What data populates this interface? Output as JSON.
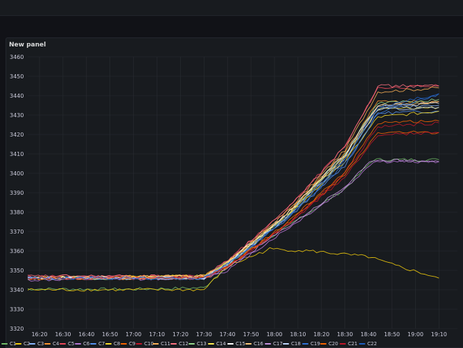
{
  "topbar": {},
  "panel": {
    "title": "New panel"
  },
  "chart_data": {
    "type": "line",
    "title": "New panel",
    "ylim": [
      3320,
      3460
    ],
    "y_ticks": [
      "3460",
      "3450",
      "3440",
      "3430",
      "3420",
      "3410",
      "3400",
      "3390",
      "3380",
      "3370",
      "3360",
      "3350",
      "3340",
      "3330",
      "3320"
    ],
    "x_ticks": [
      "16:20",
      "16:30",
      "16:40",
      "16:50",
      "17:00",
      "17:10",
      "17:20",
      "17:30",
      "17:40",
      "17:50",
      "18:00",
      "18:10",
      "18:20",
      "18:30",
      "18:40",
      "18:50",
      "19:00",
      "19:10"
    ],
    "x_minutes": [
      975,
      1150
    ],
    "grid": true,
    "legend_position": "bottom",
    "series": [
      {
        "name": "C1",
        "color": "#73bf69",
        "values": [
          [
            975,
            3340.5
          ],
          [
            1015,
            3340.2
          ],
          [
            1050,
            3341
          ],
          [
            1063,
            3356
          ],
          [
            1085,
            3372
          ],
          [
            1110,
            3392
          ],
          [
            1122,
            3407
          ],
          [
            1150,
            3407
          ]
        ]
      },
      {
        "name": "C2",
        "color": "#f2cc0c",
        "values": [
          [
            975,
            3340
          ],
          [
            1050,
            3340
          ],
          [
            1060,
            3352
          ],
          [
            1072,
            3358
          ],
          [
            1078,
            3361
          ],
          [
            1095,
            3360
          ],
          [
            1120,
            3357
          ],
          [
            1130,
            3353
          ],
          [
            1150,
            3346
          ]
        ]
      },
      {
        "name": "C3",
        "color": "#8ab8ff",
        "values": [
          [
            975,
            3346
          ],
          [
            1050,
            3346
          ],
          [
            1060,
            3353
          ],
          [
            1085,
            3378
          ],
          [
            1110,
            3409
          ],
          [
            1124,
            3434
          ],
          [
            1150,
            3435
          ]
        ]
      },
      {
        "name": "C4",
        "color": "#ff9830",
        "values": [
          [
            975,
            3346
          ],
          [
            1050,
            3347
          ],
          [
            1060,
            3354
          ],
          [
            1085,
            3379
          ],
          [
            1110,
            3411
          ],
          [
            1124,
            3437
          ],
          [
            1150,
            3437
          ]
        ]
      },
      {
        "name": "C5",
        "color": "#f2495c",
        "values": [
          [
            975,
            3347
          ],
          [
            1050,
            3347
          ],
          [
            1060,
            3355
          ],
          [
            1085,
            3381
          ],
          [
            1110,
            3414
          ],
          [
            1124,
            3444
          ],
          [
            1150,
            3445
          ]
        ]
      },
      {
        "name": "C6",
        "color": "#b877d9",
        "values": [
          [
            975,
            3345
          ],
          [
            1050,
            3346
          ],
          [
            1060,
            3350
          ],
          [
            1085,
            3371
          ],
          [
            1110,
            3392
          ],
          [
            1122,
            3406
          ],
          [
            1150,
            3406
          ]
        ]
      },
      {
        "name": "C7",
        "color": "#5794f2",
        "values": [
          [
            975,
            3346
          ],
          [
            1050,
            3346
          ],
          [
            1060,
            3353
          ],
          [
            1085,
            3376
          ],
          [
            1110,
            3404
          ],
          [
            1124,
            3431
          ],
          [
            1150,
            3432
          ]
        ]
      },
      {
        "name": "C8",
        "color": "#fade2a",
        "values": [
          [
            975,
            3346
          ],
          [
            1050,
            3347
          ],
          [
            1060,
            3353
          ],
          [
            1085,
            3377
          ],
          [
            1110,
            3406
          ],
          [
            1124,
            3429
          ],
          [
            1150,
            3432
          ]
        ]
      },
      {
        "name": "C9",
        "color": "#fa6400",
        "values": [
          [
            975,
            3346
          ],
          [
            1050,
            3346
          ],
          [
            1060,
            3352
          ],
          [
            1085,
            3374
          ],
          [
            1110,
            3399
          ],
          [
            1124,
            3421
          ],
          [
            1150,
            3421
          ]
        ]
      },
      {
        "name": "C10",
        "color": "#c4162a",
        "values": [
          [
            975,
            3346
          ],
          [
            1050,
            3346
          ],
          [
            1060,
            3352
          ],
          [
            1085,
            3373
          ],
          [
            1110,
            3400
          ],
          [
            1124,
            3424
          ],
          [
            1150,
            3426
          ]
        ]
      },
      {
        "name": "C11",
        "color": "#ffb357",
        "values": [
          [
            975,
            3346
          ],
          [
            1050,
            3346
          ],
          [
            1060,
            3354
          ],
          [
            1085,
            3380
          ],
          [
            1110,
            3412
          ],
          [
            1124,
            3442
          ],
          [
            1150,
            3444
          ]
        ]
      },
      {
        "name": "C12",
        "color": "#ff7383",
        "values": [
          [
            975,
            3347
          ],
          [
            1050,
            3347
          ],
          [
            1060,
            3355
          ],
          [
            1085,
            3381
          ],
          [
            1110,
            3414
          ],
          [
            1124,
            3445
          ],
          [
            1150,
            3445
          ]
        ]
      },
      {
        "name": "C13",
        "color": "#96d98d",
        "values": [
          [
            975,
            3346
          ],
          [
            1050,
            3346
          ],
          [
            1060,
            3354
          ],
          [
            1085,
            3378
          ],
          [
            1110,
            3410
          ],
          [
            1124,
            3436
          ],
          [
            1150,
            3438
          ]
        ]
      },
      {
        "name": "C14",
        "color": "#ffee52",
        "values": [
          [
            975,
            3346
          ],
          [
            1050,
            3347
          ],
          [
            1060,
            3354
          ],
          [
            1085,
            3378
          ],
          [
            1110,
            3408
          ],
          [
            1124,
            3433
          ],
          [
            1150,
            3434
          ]
        ]
      },
      {
        "name": "C15",
        "color": "#ffffff",
        "values": [
          [
            975,
            3346
          ],
          [
            1050,
            3346
          ],
          [
            1060,
            3354
          ],
          [
            1085,
            3379
          ],
          [
            1110,
            3410
          ],
          [
            1124,
            3435
          ],
          [
            1150,
            3436
          ]
        ]
      },
      {
        "name": "C16",
        "color": "#ffcb7d",
        "values": [
          [
            975,
            3346
          ],
          [
            1050,
            3347
          ],
          [
            1060,
            3354
          ],
          [
            1085,
            3379
          ],
          [
            1110,
            3409
          ],
          [
            1124,
            3435
          ],
          [
            1150,
            3437
          ]
        ]
      },
      {
        "name": "C17",
        "color": "#ca95e5",
        "values": [
          [
            975,
            3346
          ],
          [
            1050,
            3346
          ],
          [
            1060,
            3351
          ],
          [
            1085,
            3372
          ],
          [
            1110,
            3393
          ],
          [
            1122,
            3407
          ],
          [
            1150,
            3406
          ]
        ]
      },
      {
        "name": "C18",
        "color": "#c0d8ff",
        "values": [
          [
            975,
            3346
          ],
          [
            1050,
            3346
          ],
          [
            1060,
            3353
          ],
          [
            1085,
            3377
          ],
          [
            1110,
            3407
          ],
          [
            1124,
            3433
          ],
          [
            1150,
            3434
          ]
        ]
      },
      {
        "name": "C19",
        "color": "#3274d9",
        "values": [
          [
            975,
            3346
          ],
          [
            1050,
            3346
          ],
          [
            1060,
            3353
          ],
          [
            1085,
            3376
          ],
          [
            1110,
            3405
          ],
          [
            1124,
            3431
          ],
          [
            1150,
            3441
          ]
        ]
      },
      {
        "name": "C20",
        "color": "#fa6400",
        "values": [
          [
            975,
            3346
          ],
          [
            1050,
            3346
          ],
          [
            1060,
            3352
          ],
          [
            1085,
            3374
          ],
          [
            1110,
            3401
          ],
          [
            1124,
            3426
          ],
          [
            1150,
            3427
          ]
        ]
      },
      {
        "name": "C21",
        "color": "#c4162a",
        "values": [
          [
            975,
            3346
          ],
          [
            1050,
            3346
          ],
          [
            1060,
            3352
          ],
          [
            1085,
            3373
          ],
          [
            1110,
            3398
          ],
          [
            1124,
            3420
          ],
          [
            1150,
            3421
          ]
        ]
      },
      {
        "name": "C22",
        "color": "#1f60c4",
        "values": [
          [
            975,
            3346
          ],
          [
            1050,
            3346
          ],
          [
            1060,
            3353
          ],
          [
            1085,
            3377
          ],
          [
            1110,
            3407
          ],
          [
            1124,
            3434
          ],
          [
            1150,
            3441
          ]
        ]
      }
    ]
  }
}
